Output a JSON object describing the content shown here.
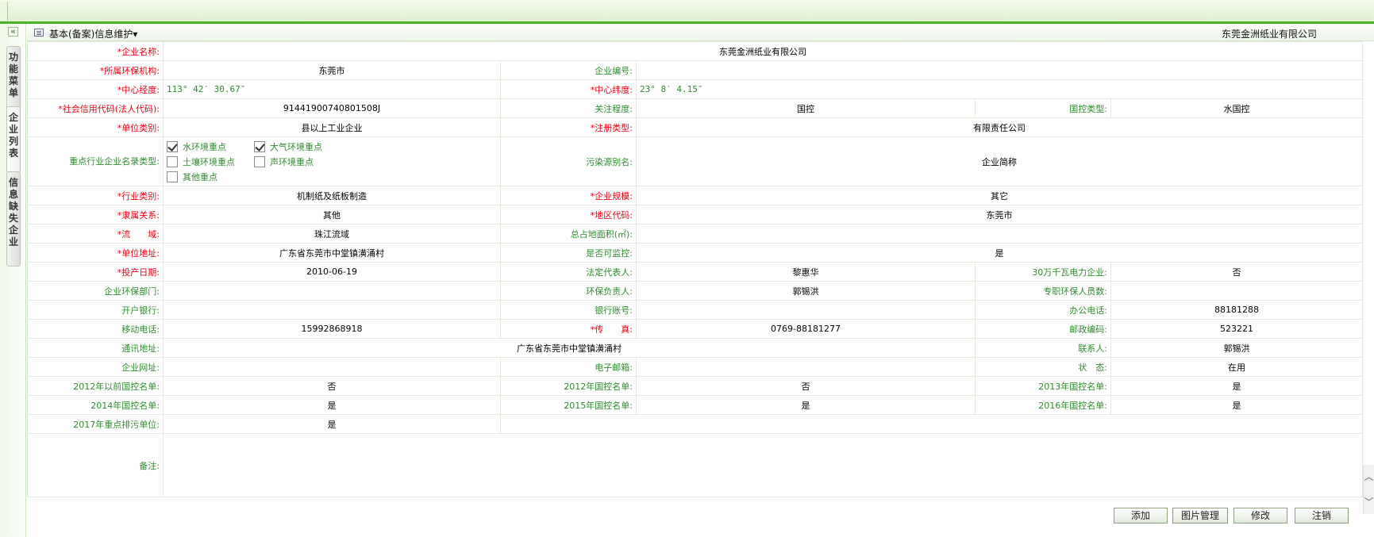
{
  "nav": {
    "collapse": "«",
    "tabs": [
      {
        "label": "功能菜单"
      },
      {
        "label": "企业列表"
      },
      {
        "label": "信息缺失企业"
      }
    ]
  },
  "header": {
    "title": "基本(备案)信息维护▾",
    "company": "东莞金洲纸业有限公司"
  },
  "rows": {
    "r1": {
      "l1": "*企业名称:",
      "v1": "东莞金洲纸业有限公司"
    },
    "r2": {
      "l1": "*所属环保机构:",
      "v1": "东莞市",
      "l2": "企业编号:",
      "v2": ""
    },
    "r3": {
      "l1": "*中心经度:",
      "v1": "113° 42′ 30.67″",
      "l2": "*中心纬度:",
      "v2": "23° 8′ 4.15″"
    },
    "r4": {
      "l1": "*社会信用代码(法人代码):",
      "v1": "91441900740801508J",
      "l2": "关注程度:",
      "v2": "国控",
      "l3": "国控类型:",
      "v3": "水国控"
    },
    "r5": {
      "l1": "*单位类别:",
      "v1": "县以上工业企业",
      "l2": "*注册类型:",
      "v2": "有限责任公司"
    },
    "r6": {
      "l1": "重点行业企业名录类型:",
      "checks": [
        {
          "label": "水环境重点",
          "checked": true
        },
        {
          "label": "大气环境重点",
          "checked": true
        },
        {
          "label": "土壤环境重点",
          "checked": false
        },
        {
          "label": "声环境重点",
          "checked": false
        },
        {
          "label": "其他重点",
          "checked": false
        }
      ],
      "l2": "污染源别名:",
      "v2": "企业简称"
    },
    "r7": {
      "l1": "*行业类别:",
      "v1": "机制纸及纸板制造",
      "l2": "*企业规模:",
      "v2": "其它"
    },
    "r8": {
      "l1": "*隶属关系:",
      "v1": "其他",
      "l2": "*地区代码:",
      "v2": "东莞市"
    },
    "r9": {
      "l1": "*流　　域:",
      "v1": "珠江流域",
      "l2": "总占地面积(㎡):",
      "v2": ""
    },
    "r10": {
      "l1": "*单位地址:",
      "v1": "广东省东莞市中堂镇潢涌村",
      "l2": "是否可监控:",
      "v2": "是"
    },
    "r11": {
      "l1": "*投产日期:",
      "v1": "2010-06-19",
      "l2": "法定代表人:",
      "v2": "黎惠华",
      "l3": "30万千瓦电力企业:",
      "v3": "否"
    },
    "r12": {
      "l1": "企业环保部门:",
      "v1": "",
      "l2": "环保负责人:",
      "v2": "郭锡洪",
      "l3": "专职环保人员数:",
      "v3": ""
    },
    "r13": {
      "l1": "开户银行:",
      "v1": "",
      "l2": "银行账号:",
      "v2": "",
      "l3": "办公电话:",
      "v3": "88181288"
    },
    "r14": {
      "l1": "移动电话:",
      "v1": "15992868918",
      "l2": "*传　　真:",
      "v2": "0769-88181277",
      "l3": "邮政编码:",
      "v3": "523221"
    },
    "r15": {
      "l1": "通讯地址:",
      "v1": "广东省东莞市中堂镇潢涌村",
      "l3": "联系人:",
      "v3": "郭锡洪"
    },
    "r16": {
      "l1": "企业网址:",
      "v1": "",
      "l2": "电子邮箱:",
      "v2": "",
      "l3": "状　态:",
      "v3": "在用"
    },
    "r17": {
      "l1": "2012年以前国控名单:",
      "v1": "否",
      "l2": "2012年国控名单:",
      "v2": "否",
      "l3": "2013年国控名单:",
      "v3": "是"
    },
    "r18": {
      "l1": "2014年国控名单:",
      "v1": "是",
      "l2": "2015年国控名单:",
      "v2": "是",
      "l3": "2016年国控名单:",
      "v3": "是"
    },
    "r19": {
      "l1": "2017年重点排污单位:",
      "v1": "是"
    },
    "r20": {
      "l1": "备注:",
      "v1": ""
    }
  },
  "scroll": {
    "up": "︿",
    "down": "﹀"
  },
  "buttons": {
    "add": "添加",
    "images": "图片管理",
    "edit": "修改",
    "cancel": "注销"
  }
}
